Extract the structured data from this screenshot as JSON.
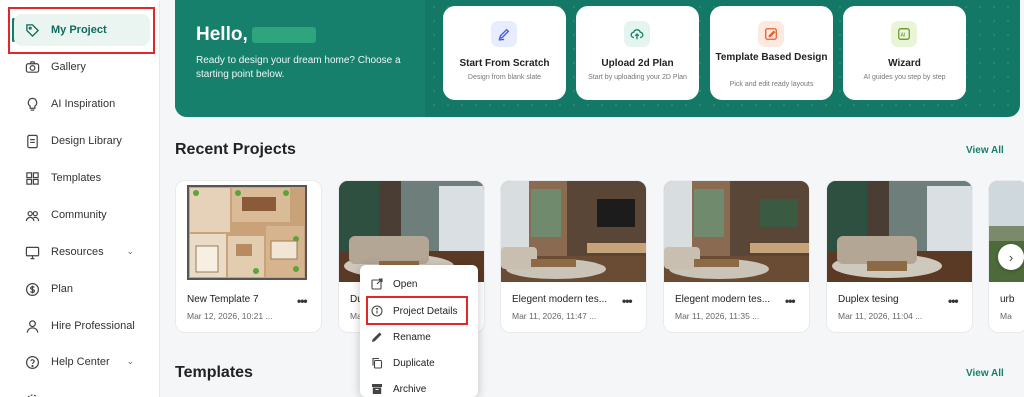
{
  "sidebar": {
    "items": [
      {
        "label": "My Project",
        "icon": "tag-icon"
      },
      {
        "label": "Gallery",
        "icon": "camera-icon"
      },
      {
        "label": "AI Inspiration",
        "icon": "lightbulb-icon"
      },
      {
        "label": "Design Library",
        "icon": "document-icon"
      },
      {
        "label": "Templates",
        "icon": "grid-icon"
      },
      {
        "label": "Community",
        "icon": "people-icon"
      },
      {
        "label": "Resources",
        "icon": "monitor-icon"
      },
      {
        "label": "Plan",
        "icon": "dollar-icon"
      },
      {
        "label": "Hire Professional",
        "icon": "person-icon"
      },
      {
        "label": "Help Center",
        "icon": "help-icon"
      }
    ]
  },
  "hero": {
    "greeting": "Hello,",
    "subtitle": "Ready to design your dream home? Choose a starting point below.",
    "cards": [
      {
        "title": "Start From Scratch",
        "desc": "Design from blank slate",
        "icon": "pencil-icon"
      },
      {
        "title": "Upload 2d Plan",
        "desc": "Start by uploading your 2D Plan",
        "icon": "cloud-upload-icon"
      },
      {
        "title": "Template Based Design",
        "desc": "Pick and edit ready layouts",
        "icon": "template-edit-icon"
      },
      {
        "title": "Wizard",
        "desc": "AI guides you step by step",
        "icon": "ai-icon"
      }
    ]
  },
  "recent": {
    "title": "Recent Projects",
    "view_all": "View All",
    "projects": [
      {
        "name": "New Template 7",
        "date": "Mar 12, 2026, 10:21 ..."
      },
      {
        "name": "Du",
        "date": "Ma"
      },
      {
        "name": "Elegent modern tes...",
        "date": "Mar 11, 2026, 11:47 ..."
      },
      {
        "name": "Elegent modern tes...",
        "date": "Mar 11, 2026, 11:35 ..."
      },
      {
        "name": "Duplex tesing",
        "date": "Mar 11, 2026, 11:04 ..."
      },
      {
        "name": "urb",
        "date": "Ma"
      }
    ]
  },
  "menu": {
    "items": [
      {
        "label": "Open",
        "icon": "open-external-icon"
      },
      {
        "label": "Project Details",
        "icon": "info-icon"
      },
      {
        "label": "Rename",
        "icon": "pencil-icon"
      },
      {
        "label": "Duplicate",
        "icon": "copy-icon"
      },
      {
        "label": "Archive",
        "icon": "archive-icon"
      }
    ]
  },
  "templates": {
    "title": "Templates",
    "view_all": "View All"
  },
  "colors": {
    "brand": "#16806c",
    "highlight": "#e0282b"
  }
}
